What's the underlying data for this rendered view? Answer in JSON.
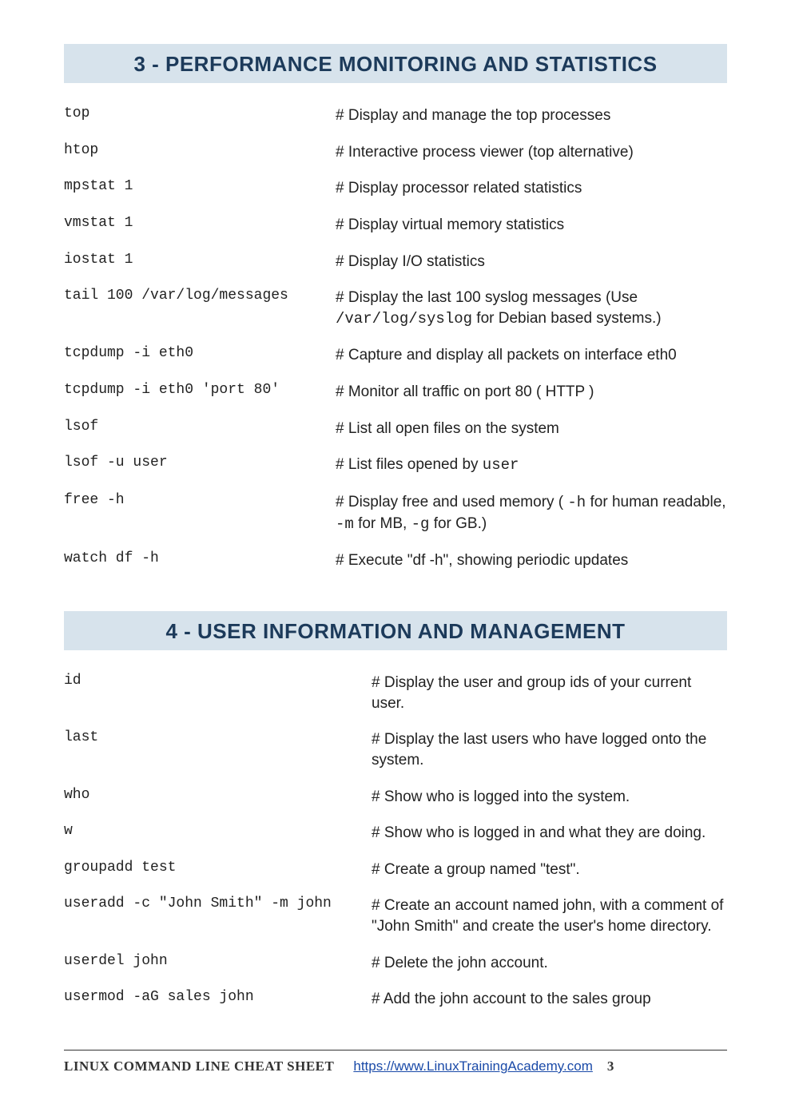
{
  "sections": [
    {
      "title": "3 - PERFORMANCE MONITORING AND STATISTICS",
      "colClass": "section3",
      "items": [
        {
          "cmd": "top",
          "desc_html": "# Display and manage the top processes"
        },
        {
          "cmd": "htop",
          "desc_html": "# Interactive process viewer (top alternative)"
        },
        {
          "cmd": "mpstat 1",
          "desc_html": "# Display processor related statistics"
        },
        {
          "cmd": "vmstat 1",
          "desc_html": "# Display virtual memory statistics"
        },
        {
          "cmd": "iostat 1",
          "desc_html": "# Display I/O statistics"
        },
        {
          "cmd": "tail 100 /var/log/messages",
          "desc_html": "# Display the last 100 syslog messages  (Use <span class=\"mono\">/var/log/syslog</span> for Debian based systems.)"
        },
        {
          "cmd": "tcpdump -i eth0",
          "desc_html": "# Capture and display all packets on interface eth0"
        },
        {
          "cmd": "tcpdump -i eth0 'port 80'",
          "desc_html": "# Monitor all traffic on port 80 ( HTTP )"
        },
        {
          "cmd": "lsof",
          "desc_html": "# List all open files on the system"
        },
        {
          "cmd": "lsof -u user",
          "desc_html": "# List files opened by <span class=\"mono\">user</span>"
        },
        {
          "cmd": "free -h",
          "desc_html": "# Display free and used memory ( <span class=\"mono\">-h</span> for human readable, <span class=\"mono\">-m</span> for MB, <span class=\"mono\">-g</span> for GB.)"
        },
        {
          "cmd": "watch df -h",
          "desc_html": "# Execute \"df -h\", showing periodic updates"
        }
      ]
    },
    {
      "title": "4 - USER INFORMATION AND MANAGEMENT",
      "colClass": "section4",
      "items": [
        {
          "cmd": "id",
          "desc_html": "# Display the user and group ids of your current user."
        },
        {
          "cmd": "last",
          "desc_html": "# Display the last users who have logged onto the system."
        },
        {
          "cmd": "who",
          "desc_html": "# Show who is logged into the system."
        },
        {
          "cmd": "w",
          "desc_html": "# Show who is logged in and what they are doing."
        },
        {
          "cmd": "groupadd test",
          "desc_html": "# Create a group named \"test\"."
        },
        {
          "cmd": "useradd -c \"John Smith\" -m john",
          "desc_html": "# Create an account named john, with a comment of \"John Smith\" and create the user's home directory."
        },
        {
          "cmd": "userdel john",
          "desc_html": "# Delete the john account."
        },
        {
          "cmd": "usermod -aG sales john",
          "desc_html": "# Add the john account to the sales group"
        }
      ]
    }
  ],
  "footer": {
    "title": "LINUX COMMAND LINE CHEAT SHEET",
    "url": "https://www.LinuxTrainingAcademy.com",
    "page": "3"
  }
}
